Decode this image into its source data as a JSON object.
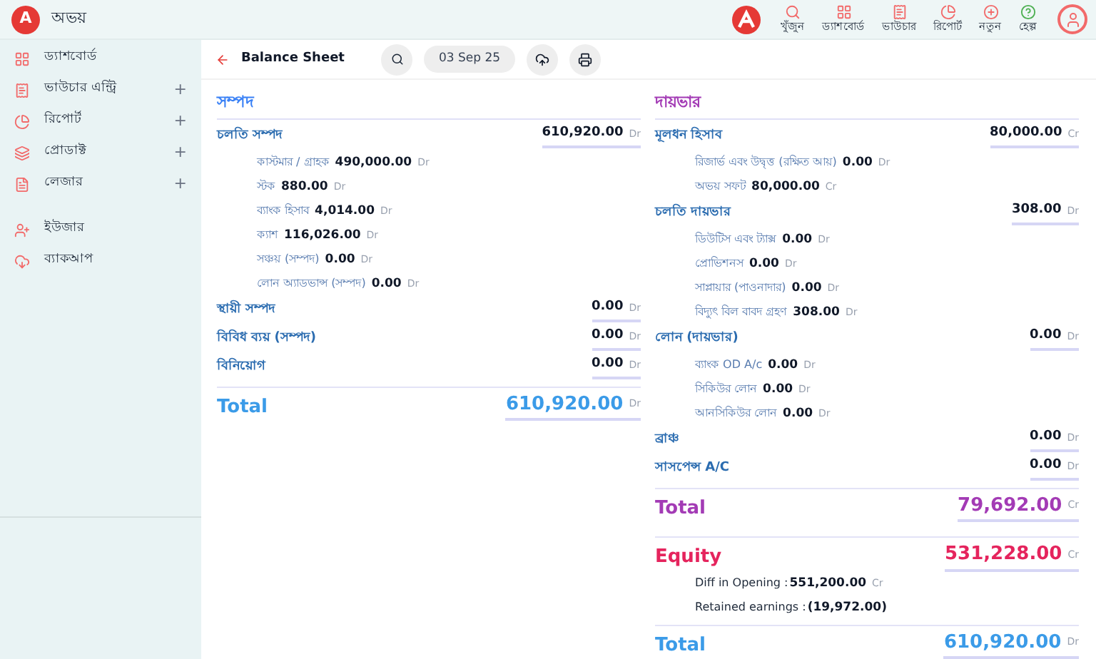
{
  "app": {
    "avatar_letter": "A",
    "name": "অভয়"
  },
  "sidebar": {
    "items": [
      {
        "label": "ড্যাশবোর্ড"
      },
      {
        "label": "ভাউচার এন্ট্রি",
        "plus": "+"
      },
      {
        "label": "রিপোর্ট",
        "plus": "+"
      },
      {
        "label": "প্রোডাক্ট",
        "plus": "+"
      },
      {
        "label": "লেজার",
        "plus": "+"
      },
      {
        "label": "ইউজার"
      },
      {
        "label": "ব্যাকআপ"
      }
    ]
  },
  "topnav": [
    {
      "label": "খুঁজুন"
    },
    {
      "label": "ড্যাশবোর্ড"
    },
    {
      "label": "ভাউচার"
    },
    {
      "label": "রিপোর্ট"
    },
    {
      "label": "নতুন"
    },
    {
      "label": "হেল্প"
    }
  ],
  "toolbar": {
    "title": "Balance Sheet",
    "date": "03 Sep 25"
  },
  "assets": {
    "heading": "সম্পদ",
    "groups": [
      {
        "label": "চলতি সম্পদ",
        "amount": "610,920.00",
        "unit": "Dr",
        "items": [
          {
            "label": "কাস্টমার / গ্রাহক",
            "amount": "490,000.00",
            "unit": "Dr"
          },
          {
            "label": "স্টক",
            "amount": "880.00",
            "unit": "Dr"
          },
          {
            "label": "ব্যাংক হিসাব",
            "amount": "4,014.00",
            "unit": "Dr"
          },
          {
            "label": "ক্যাশ",
            "amount": "116,026.00",
            "unit": "Dr"
          },
          {
            "label": "সঞ্চয় (সম্পদ)",
            "amount": "0.00",
            "unit": "Dr"
          },
          {
            "label": "লোন অ্যাডভান্স (সম্পদ)",
            "amount": "0.00",
            "unit": "Dr"
          }
        ]
      },
      {
        "label": "স্থায়ী সম্পদ",
        "amount": "0.00",
        "unit": "Dr"
      },
      {
        "label": "বিবিধ ব্যয় (সম্পদ)",
        "amount": "0.00",
        "unit": "Dr"
      },
      {
        "label": "বিনিয়োগ",
        "amount": "0.00",
        "unit": "Dr"
      }
    ],
    "total": {
      "label": "Total",
      "amount": "610,920.00",
      "unit": "Dr"
    }
  },
  "liabilities": {
    "heading": "দায়ভার",
    "groups": [
      {
        "label": "মূলধন হিসাব",
        "amount": "80,000.00",
        "unit": "Cr",
        "items": [
          {
            "label": "রিজার্ভ এবং উদ্বৃত্ত (রক্ষিত আয়)",
            "amount": "0.00",
            "unit": "Dr"
          },
          {
            "label": "অভয় সফট",
            "amount": "80,000.00",
            "unit": "Cr"
          }
        ]
      },
      {
        "label": "চলতি দায়ভার",
        "amount": "308.00",
        "unit": "Dr",
        "items": [
          {
            "label": "ডিউটিস এবং ট্যাক্স",
            "amount": "0.00",
            "unit": "Dr"
          },
          {
            "label": "প্রোভিশনস",
            "amount": "0.00",
            "unit": "Dr"
          },
          {
            "label": "সাপ্লায়ার (পাওনাদার)",
            "amount": "0.00",
            "unit": "Dr"
          },
          {
            "label": "বিদ্যুৎ বিল বাবদ গ্রহণ",
            "amount": "308.00",
            "unit": "Dr"
          }
        ]
      },
      {
        "label": "লোন (দায়ভার)",
        "amount": "0.00",
        "unit": "Dr",
        "items": [
          {
            "label": "ব্যাংক OD A/c",
            "amount": "0.00",
            "unit": "Dr"
          },
          {
            "label": "সিকিউর লোন",
            "amount": "0.00",
            "unit": "Dr"
          },
          {
            "label": "আনসিকিউর লোন",
            "amount": "0.00",
            "unit": "Dr"
          }
        ]
      },
      {
        "label": "ব্রাঞ্চ",
        "amount": "0.00",
        "unit": "Dr"
      },
      {
        "label": "সাসপেন্স A/C",
        "amount": "0.00",
        "unit": "Dr"
      }
    ],
    "total": {
      "label": "Total",
      "amount": "79,692.00",
      "unit": "Cr"
    }
  },
  "equity": {
    "label": "Equity",
    "amount": "531,228.00",
    "unit": "Cr",
    "items": [
      {
        "label": "Diff in Opening :",
        "amount": "551,200.00",
        "unit": "Cr"
      },
      {
        "label": "Retained earnings :",
        "amount": "(19,972.00)"
      }
    ]
  },
  "grand_total": {
    "label": "Total",
    "amount": "610,920.00",
    "unit": "Dr"
  }
}
